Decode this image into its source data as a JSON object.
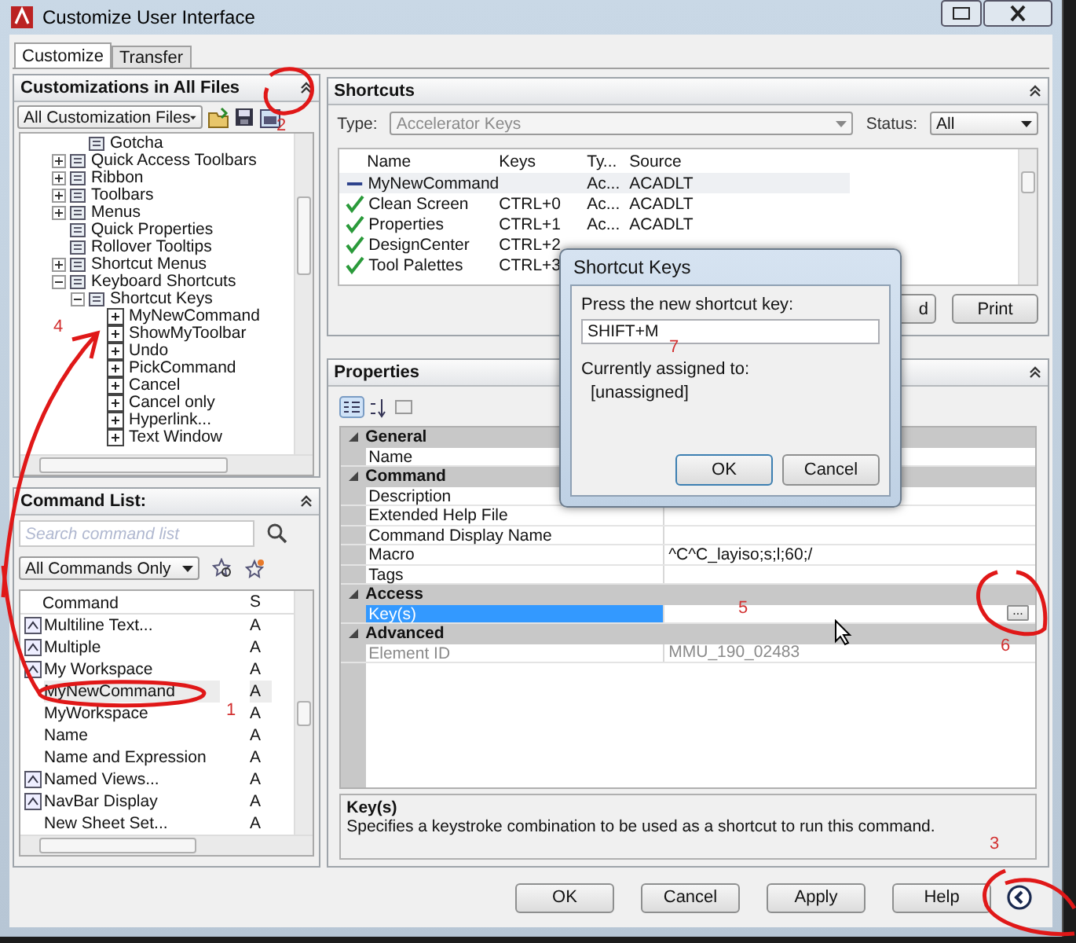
{
  "window": {
    "title": "Customize User Interface"
  },
  "tabs": [
    {
      "label": "Customize",
      "selected": true
    },
    {
      "label": "Transfer",
      "selected": false
    }
  ],
  "customizations": {
    "title": "Customizations in All Files",
    "file_filter": "All Customization Files",
    "tree": [
      {
        "children": [
          {
            "label": "Gotcha"
          }
        ]
      },
      {
        "label": "Quick Access Toolbars",
        "expanded": false
      },
      {
        "label": "Ribbon",
        "expanded": false
      },
      {
        "label": "Toolbars",
        "expanded": false
      },
      {
        "label": "Menus",
        "expanded": false
      },
      {
        "label": "Quick Properties"
      },
      {
        "label": "Rollover Tooltips"
      },
      {
        "label": "Shortcut Menus",
        "expanded": false
      },
      {
        "label": "Keyboard Shortcuts",
        "expanded": true,
        "children": [
          {
            "label": "Shortcut Keys",
            "expanded": true,
            "children": [
              {
                "label": "MyNewCommand"
              },
              {
                "label": "ShowMyToolbar"
              },
              {
                "label": "Undo"
              },
              {
                "label": "PickCommand"
              },
              {
                "label": "Cancel"
              },
              {
                "label": "Cancel only"
              },
              {
                "label": "Hyperlink..."
              },
              {
                "label": "Text Window"
              }
            ]
          }
        ]
      }
    ]
  },
  "command_list": {
    "title": "Command List:",
    "search": {
      "placeholder": "Search command list"
    },
    "filter": "All Commands Only",
    "columns": [
      "Command",
      "S"
    ],
    "rows": [
      {
        "cells": [
          "Multiline Text...",
          "A"
        ],
        "has_icon": true,
        "selected": false
      },
      {
        "cells": [
          "Multiple",
          "A"
        ],
        "has_icon": true,
        "selected": false
      },
      {
        "cells": [
          "My Workspace",
          "A"
        ],
        "has_icon": true,
        "selected": false
      },
      {
        "cells": [
          "MyNewCommand",
          "A"
        ],
        "has_icon": false,
        "selected": true
      },
      {
        "cells": [
          "MyWorkspace",
          "A"
        ],
        "has_icon": false,
        "selected": false
      },
      {
        "cells": [
          "Name",
          "A"
        ],
        "has_icon": false,
        "selected": false
      },
      {
        "cells": [
          "Name and Expression",
          "A"
        ],
        "has_icon": false,
        "selected": false
      },
      {
        "cells": [
          "Named Views...",
          "A"
        ],
        "has_icon": true,
        "selected": false
      },
      {
        "cells": [
          "NavBar Display",
          "A"
        ],
        "has_icon": true,
        "selected": false
      },
      {
        "cells": [
          "New Sheet Set...",
          "A"
        ],
        "has_icon": false,
        "selected": false
      }
    ]
  },
  "shortcuts": {
    "title": "Shortcuts",
    "type_label": "Type:",
    "type_value": "Accelerator Keys",
    "status_label": "Status:",
    "status_value": "All",
    "columns": [
      "Name",
      "Keys",
      "Ty...",
      "Source"
    ],
    "rows": [
      {
        "kind": "new",
        "name": "MyNewCommand",
        "type": "Ac...",
        "source": "ACADLT",
        "selected": true
      },
      {
        "kind": "assigned",
        "name": "Clean Screen",
        "keys": "CTRL+0",
        "type": "Ac...",
        "source": "ACADLT",
        "selected": false
      },
      {
        "kind": "assigned",
        "name": "Properties",
        "keys": "CTRL+1",
        "type": "Ac...",
        "source": "ACADLT",
        "selected": false
      },
      {
        "kind": "assigned",
        "name": "DesignCenter",
        "keys": "CTRL+2",
        "selected": false
      },
      {
        "kind": "assigned",
        "name": "Tool Palettes",
        "keys": "CTRL+3",
        "selected": false
      }
    ],
    "buttons": [
      "d",
      "Print"
    ]
  },
  "properties": {
    "title": "Properties",
    "categories": [
      {
        "label": "General",
        "rows": [
          {
            "name": "Name",
            "selected": false,
            "disabled": false
          }
        ]
      },
      {
        "label": "Command",
        "rows": [
          {
            "name": "Description",
            "selected": false,
            "disabled": false
          },
          {
            "name": "Extended Help File",
            "selected": false,
            "disabled": false
          },
          {
            "name": "Command Display Name",
            "selected": false,
            "disabled": false
          },
          {
            "name": "Macro",
            "value": "^C^C_layiso;s;l;60;/",
            "selected": false,
            "disabled": false
          },
          {
            "name": "Tags",
            "selected": false,
            "disabled": false
          }
        ]
      },
      {
        "label": "Access",
        "rows": [
          {
            "name": "Key(s)",
            "button": "...",
            "selected": true,
            "disabled": false
          }
        ]
      },
      {
        "label": "Advanced",
        "rows": [
          {
            "name": "Element ID",
            "value": "MMU_190_02483",
            "selected": false,
            "disabled": true
          }
        ]
      }
    ],
    "help_title": "Key(s)",
    "help_text": "Specifies a keystroke combination to be used as a shortcut to run this command."
  },
  "buttons": [
    "OK",
    "Cancel",
    "Apply",
    "Help"
  ],
  "dialog": {
    "title": "Shortcut Keys",
    "prompt": "Press the new shortcut key:",
    "value": "SHIFT+M",
    "assigned_label": "Currently assigned to:",
    "assigned_value": "[unassigned]",
    "buttons": [
      "OK",
      "Cancel"
    ]
  },
  "annotations": [
    {
      "label": "2"
    },
    {
      "label": "4"
    },
    {
      "label": "7"
    },
    {
      "label": "5"
    },
    {
      "label": "6"
    },
    {
      "label": "1"
    },
    {
      "label": "3"
    }
  ]
}
